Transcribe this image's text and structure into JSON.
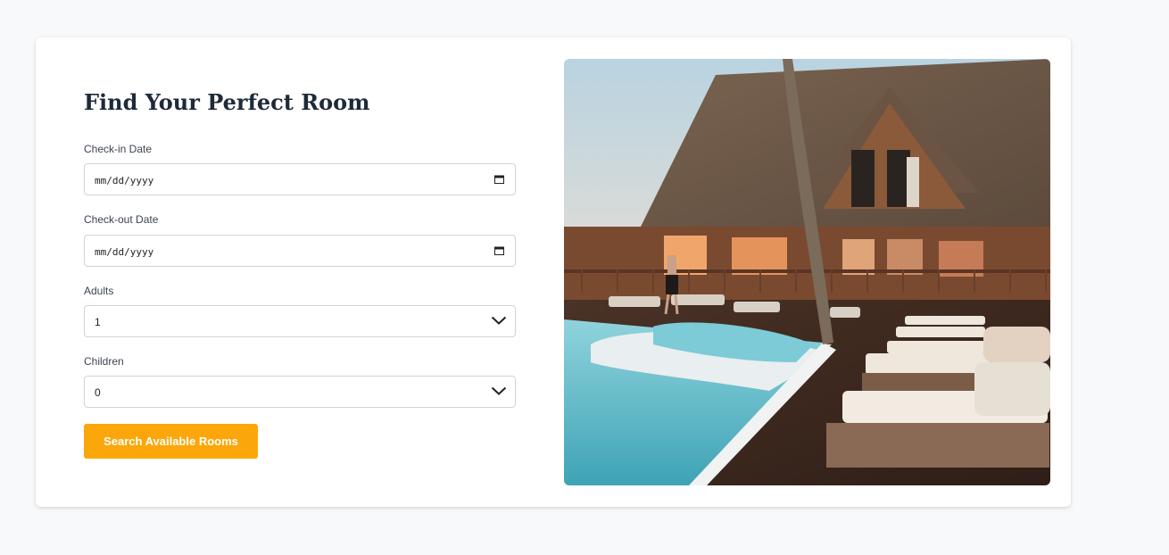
{
  "form": {
    "title": "Find Your Perfect Room",
    "checkin": {
      "label": "Check-in Date",
      "value": "mm/dd/yyyy"
    },
    "checkout": {
      "label": "Check-out Date",
      "value": "mm/dd/yyyy"
    },
    "adults": {
      "label": "Adults",
      "value": "1"
    },
    "children": {
      "label": "Children",
      "value": "0"
    },
    "search_label": "Search Available Rooms"
  },
  "photo": {
    "subject": "resort lodge with pool and sun loungers"
  },
  "icons": [
    "calendar-icon",
    "chevron-down-icon"
  ],
  "colors": {
    "accent": "#fba70b",
    "title": "#1e2a3a",
    "page_bg": "#f8f9fb",
    "card_bg": "#ffffff"
  }
}
